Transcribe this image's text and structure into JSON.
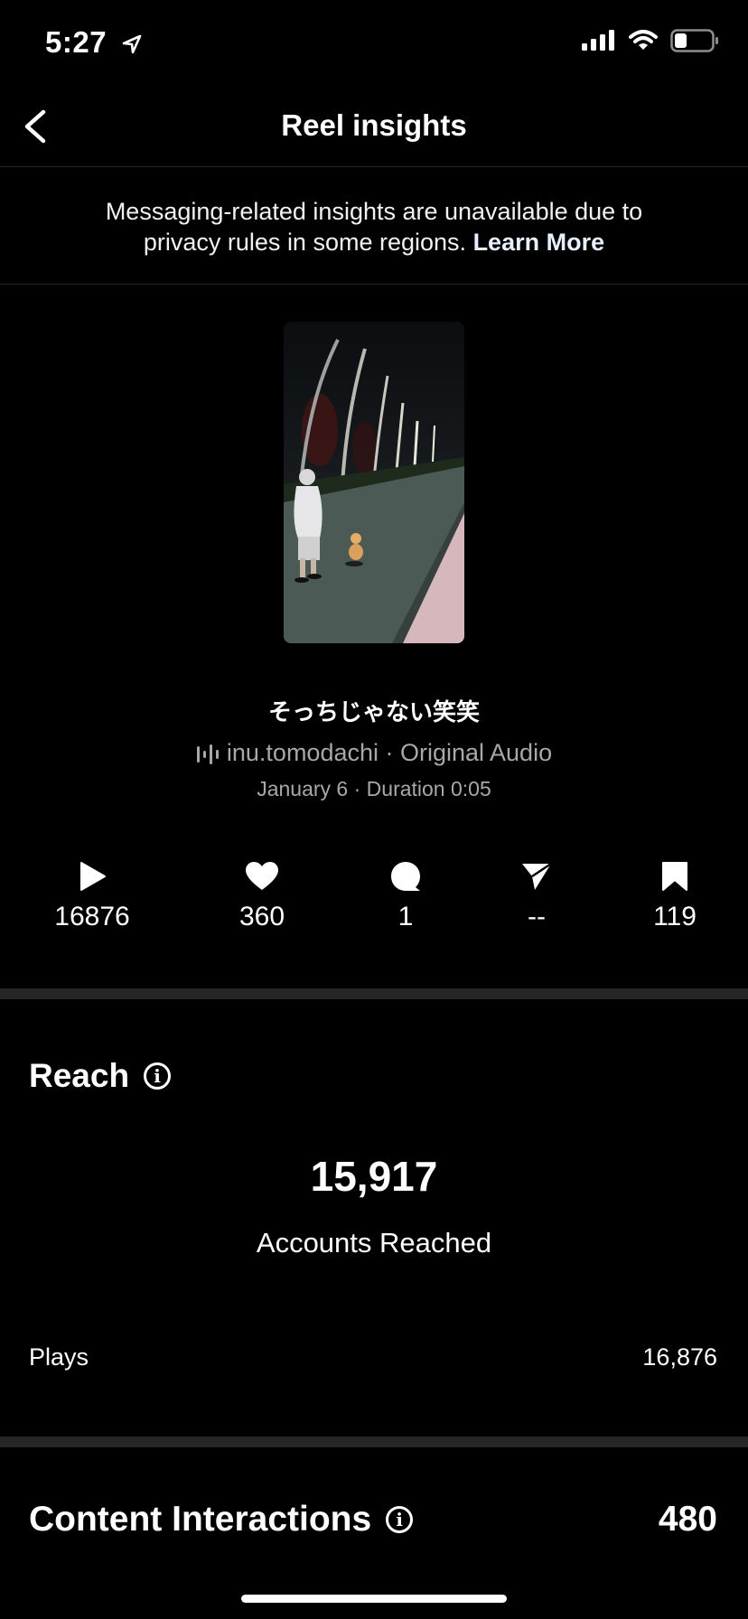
{
  "status": {
    "time": "5:27"
  },
  "nav": {
    "title": "Reel insights"
  },
  "notice": {
    "line1": "Messaging-related insights are unavailable due to",
    "line2": "privacy rules in some regions.",
    "link": "Learn More"
  },
  "reel": {
    "caption": "そっちじゃない笑笑",
    "audio": "inu.tomodachi · Original Audio",
    "date_line": "January 6 · Duration 0:05"
  },
  "metrics": {
    "plays": "16876",
    "likes": "360",
    "comments": "1",
    "shares": "--",
    "saves": "119"
  },
  "reach": {
    "title": "Reach",
    "value": "15,917",
    "label": "Accounts Reached",
    "plays_label": "Plays",
    "plays_value": "16,876"
  },
  "interactions": {
    "title": "Content Interactions",
    "value": "480"
  },
  "icons": [
    "location-arrow-icon",
    "signal-icon",
    "wifi-icon",
    "battery-icon",
    "back-chevron-icon",
    "audio-wave-icon",
    "play-icon",
    "heart-icon",
    "comment-icon",
    "send-icon",
    "bookmark-icon",
    "info-icon"
  ]
}
